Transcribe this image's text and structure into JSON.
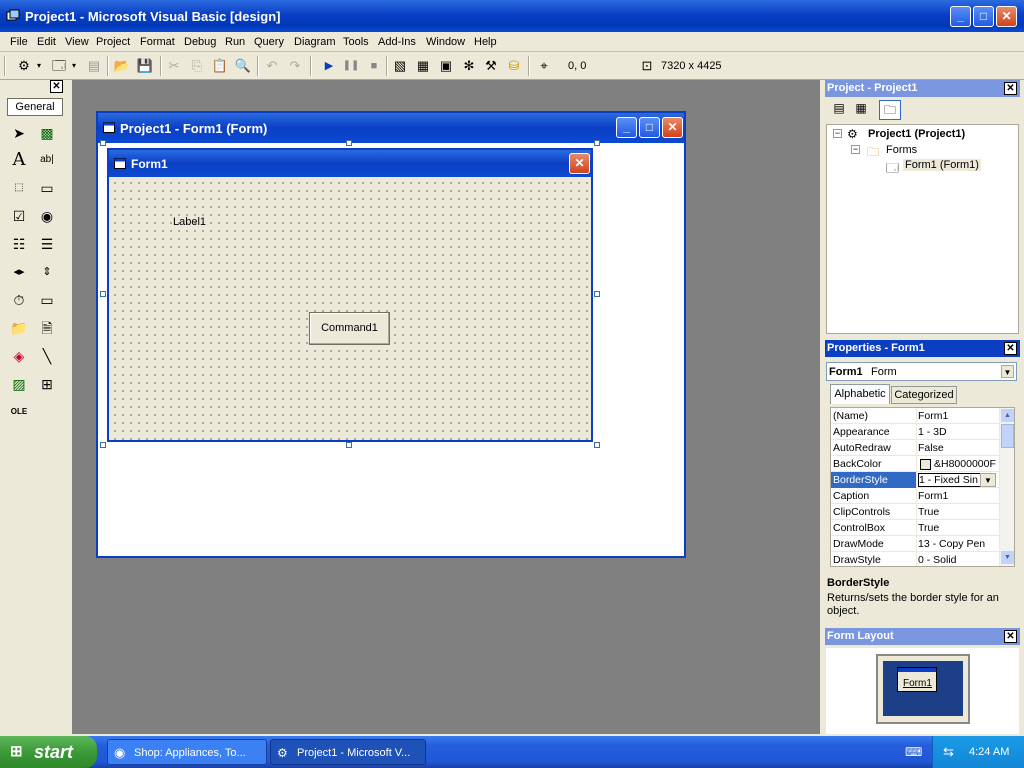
{
  "app": {
    "title": "Project1 - Microsoft Visual Basic [design]"
  },
  "menu": [
    "File",
    "Edit",
    "View",
    "Project",
    "Format",
    "Debug",
    "Run",
    "Query",
    "Diagram",
    "Tools",
    "Add-Ins",
    "Window",
    "Help"
  ],
  "toolbar": {
    "position": "0, 0",
    "size": "7320 x 4425"
  },
  "toolbox": {
    "tab": "General"
  },
  "designer": {
    "title": "Project1 - Form1 (Form)"
  },
  "form": {
    "title": "Form1",
    "label": "Label1",
    "command": "Command1"
  },
  "project_panel": {
    "title": "Project - Project1",
    "tree": [
      "Project1 (Project1)",
      "Forms",
      "Form1 (Form1)"
    ]
  },
  "properties_panel": {
    "title": "Properties - Form1",
    "object": "Form1",
    "object_type": "Form",
    "tabs": [
      "Alphabetic",
      "Categorized"
    ],
    "rows": [
      {
        "name": "(Name)",
        "value": "Form1"
      },
      {
        "name": "Appearance",
        "value": "1 - 3D"
      },
      {
        "name": "AutoRedraw",
        "value": "False"
      },
      {
        "name": "BackColor",
        "value": "&H8000000F"
      },
      {
        "name": "BorderStyle",
        "value": "1 - Fixed Sin"
      },
      {
        "name": "Caption",
        "value": "Form1"
      },
      {
        "name": "ClipControls",
        "value": "True"
      },
      {
        "name": "ControlBox",
        "value": "True"
      },
      {
        "name": "DrawMode",
        "value": "13 - Copy Pen"
      },
      {
        "name": "DrawStyle",
        "value": "0 - Solid"
      }
    ],
    "desc_title": "BorderStyle",
    "desc_text": "Returns/sets the border style for an object."
  },
  "layout_panel": {
    "title": "Form Layout",
    "form_label": "Form1"
  },
  "taskbar": {
    "start": "start",
    "tasks": [
      "Shop: Appliances, To...",
      "Project1 - Microsoft V..."
    ],
    "time": "4:24 AM"
  },
  "colors": {
    "xp_blue": "#0a3fc4",
    "workspace": "#808080",
    "face": "#ece9d8",
    "selection": "#316ac5"
  }
}
